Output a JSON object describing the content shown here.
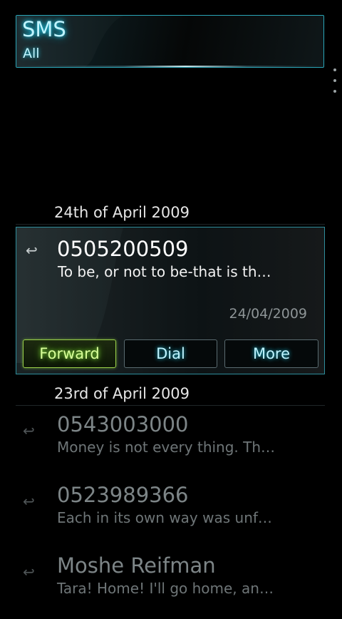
{
  "header": {
    "title": "SMS",
    "filter": "All"
  },
  "menu": {
    "icon": "overflow-menu-icon"
  },
  "sections": [
    {
      "date": "24th of April 2009"
    },
    {
      "date": "23rd of April 2009"
    }
  ],
  "selected": {
    "icon": "reply-arrow-icon",
    "sender": "0505200509",
    "preview": "To be, or not to be-that is th…",
    "date": "24/04/2009",
    "actions": {
      "forward": "Forward",
      "dial": "Dial",
      "more": "More"
    }
  },
  "messages": [
    {
      "sender": "0543003000",
      "preview": "Money is not every thing. Th…",
      "icon": "reply-arrow-icon"
    },
    {
      "sender": "0523989366",
      "preview": "Each in its own way was unf…",
      "icon": "reply-arrow-icon"
    },
    {
      "sender": "Moshe Reifman",
      "preview": "Tara! Home! I'll go home, an…",
      "icon": "reply-arrow-icon"
    }
  ],
  "colors": {
    "accent_cyan": "#1fd2f0",
    "accent_green": "#9ad04a",
    "background": "#000000"
  }
}
